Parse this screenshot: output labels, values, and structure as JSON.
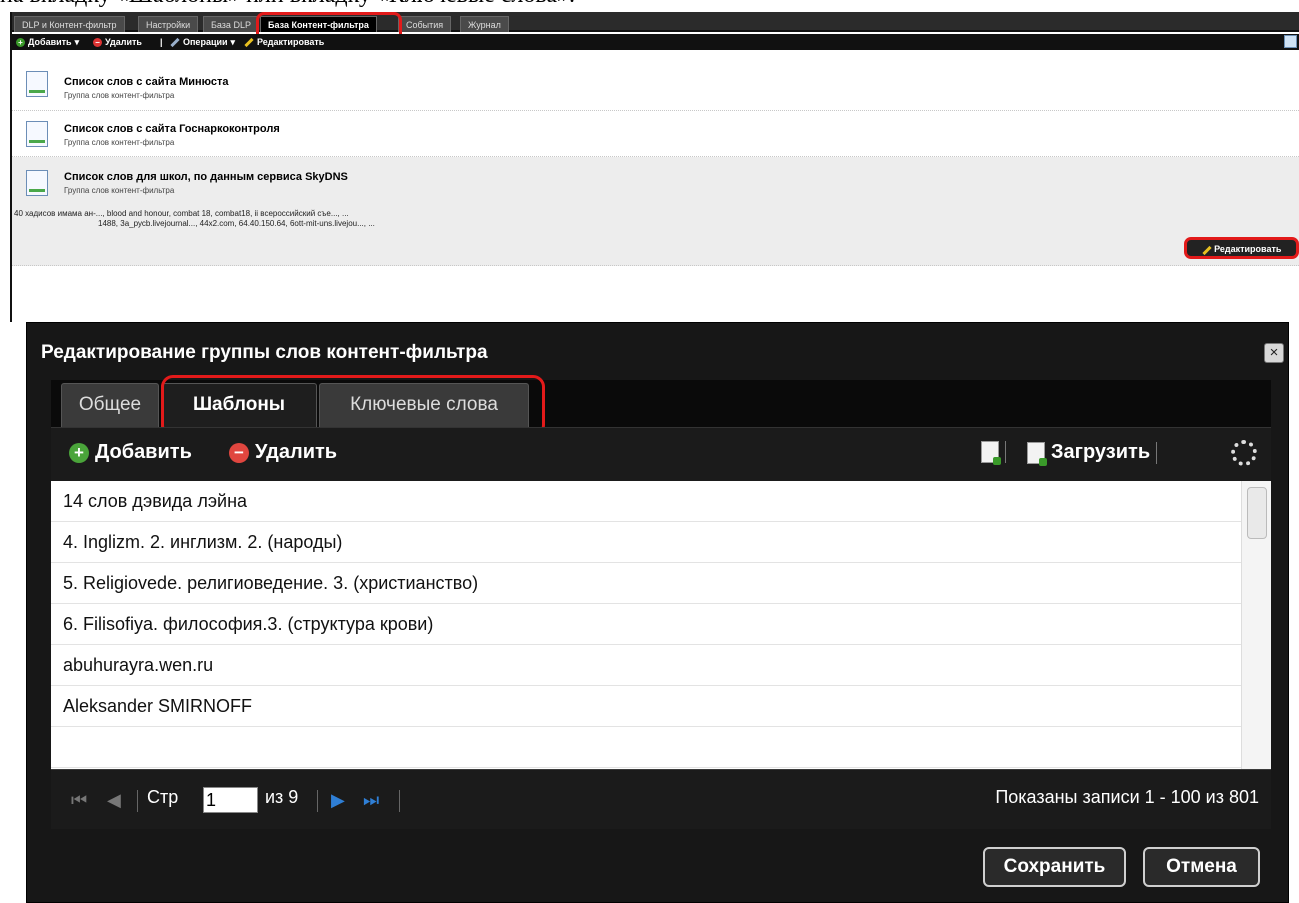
{
  "caption": "на вкладку «Шаблоны» или вкладку «Ключевые слова».",
  "top_tabs": [
    "DLP и Контент-фильтр",
    "Настройки",
    "База DLP",
    "База Контент-фильтра",
    "События",
    "Журнал"
  ],
  "top_tabs_active": "База Контент-фильтра",
  "toolbar": {
    "add": "Добавить",
    "delete": "Удалить",
    "operations": "Операции",
    "edit": "Редактировать"
  },
  "groups": [
    {
      "title": "Список слов с сайта Минюста",
      "subtitle": "Группа слов контент-фильтра"
    },
    {
      "title": "Список слов с сайта Госнаркоконтроля",
      "subtitle": "Группа слов контент-фильтра"
    },
    {
      "title": "Список слов для школ, по данным сервиса SkyDNS",
      "subtitle": "Группа слов контент-фильтра",
      "words_line1": "40 хадисов имама ан-..., blood and honour, combat 18, combat18, ii всероссийский съе..., ...",
      "words_line2": "1488, 3а_русb.livejournal..., 44x2.com, 64.40.150.64, 6ott-mit-uns.livejou..., ..."
    }
  ],
  "row_edit_button": "Редактировать",
  "dialog": {
    "title": "Редактирование группы слов контент-фильтра",
    "close": "×",
    "tabs": [
      "Общее",
      "Шаблоны",
      "Ключевые слова"
    ],
    "active_tab": "Шаблоны",
    "toolbar": {
      "add": "Добавить",
      "delete": "Удалить",
      "upload": "Загрузить"
    },
    "items": [
      "14 слов дэвида лэйна",
      "4. Inglizm. 2. инглизм. 2. (народы)",
      "5. Religiovede. религиоведение. 3. (христианство)",
      "6. Filisofiya. философия.3. (структура крови)",
      "abuhurayra.wen.ru",
      "Aleksander SMIRNOFF",
      ""
    ],
    "pager": {
      "page_label": "Стр",
      "page_value": "1",
      "of_label": "из 9",
      "summary": "Показаны записи 1 - 100 из 801"
    },
    "buttons": {
      "save": "Сохранить",
      "cancel": "Отмена"
    }
  },
  "colors": {
    "highlight": "#e21a1a",
    "dark_bg": "#171717",
    "accent_green": "#4aa43a",
    "accent_red": "#e0463f"
  }
}
